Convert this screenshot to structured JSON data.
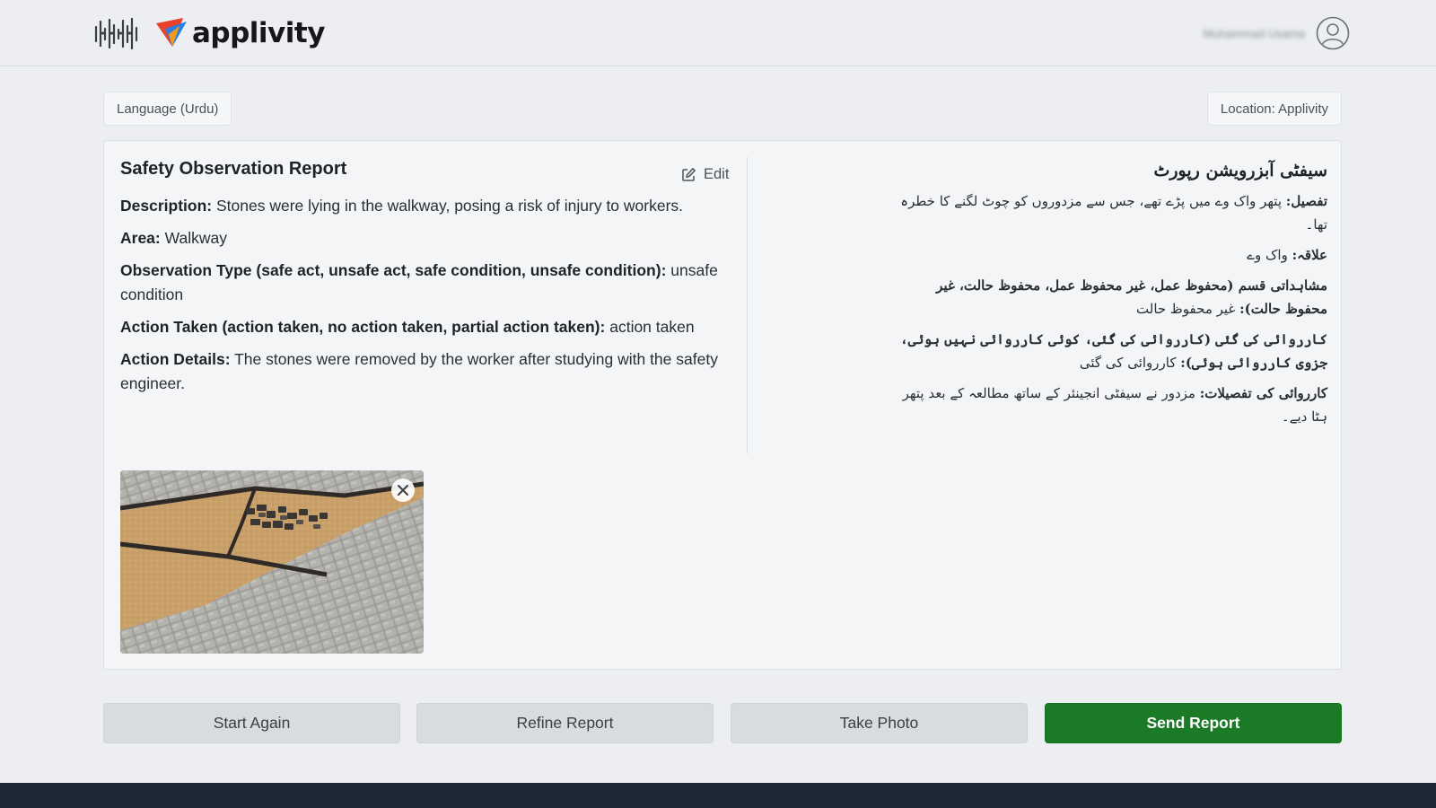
{
  "app": {
    "brand": "applivity",
    "user_name": "Muhammad Usama"
  },
  "filters": {
    "language": "Language (Urdu)",
    "location": "Location: Applivity"
  },
  "report": {
    "title": "Safety Observation Report",
    "edit_label": "Edit",
    "fields": [
      {
        "label": "Description:",
        "value": "Stones were lying in the walkway, posing a risk of injury to workers."
      },
      {
        "label": "Area:",
        "value": "Walkway"
      },
      {
        "label": "Observation Type (safe act, unsafe act, safe condition, unsafe condition):",
        "value": "unsafe condition"
      },
      {
        "label": "Action Taken (action taken, no action taken, partial action taken):",
        "value": "action taken"
      },
      {
        "label": "Action Details:",
        "value": "The stones were removed by the worker after studying with the safety engineer."
      }
    ]
  },
  "urdu": {
    "title": "سیفٹی آبزرویشن رپورٹ",
    "lines": [
      {
        "label": "تفصیل:",
        "value": "پتھر واک وے میں پڑے تھے، جس سے مزدوروں کو چوٹ لگنے کا خطرہ تھا۔"
      },
      {
        "label": "علاقہ:",
        "value": "واک وے"
      },
      {
        "label": "مشاہداتی قسم (محفوظ عمل، غیر محفوظ عمل، محفوظ حالت، غیر محفوظ حالت):",
        "value": "غیر محفوظ حالت"
      },
      {
        "label": "کارروائی کی گئی (کارروائی کی گئی، کوئی کارروائی نہیں ہوئی، جزوی کارروائی ہوئی):",
        "value": "کارروائی کی گئی"
      },
      {
        "label": "کارروائی کی تفصیلات:",
        "value": "مزدور نے سیفٹی انجینئر کے ساتھ مطالعہ کے بعد پتھر ہٹا دیے۔"
      }
    ]
  },
  "actions": {
    "start_again": "Start Again",
    "refine_report": "Refine Report",
    "take_photo": "Take Photo",
    "send_report": "Send Report"
  },
  "colors": {
    "send_button": "#1a7a26",
    "footer": "#1e2935",
    "brand_red": "#e8412c",
    "brand_blue": "#2a7de1"
  },
  "icons": {
    "wave_logo": "waveform-logo-icon",
    "brand_mark": "applivity-logo-icon",
    "avatar": "user-avatar-icon",
    "edit": "edit-icon",
    "close": "close-icon"
  }
}
